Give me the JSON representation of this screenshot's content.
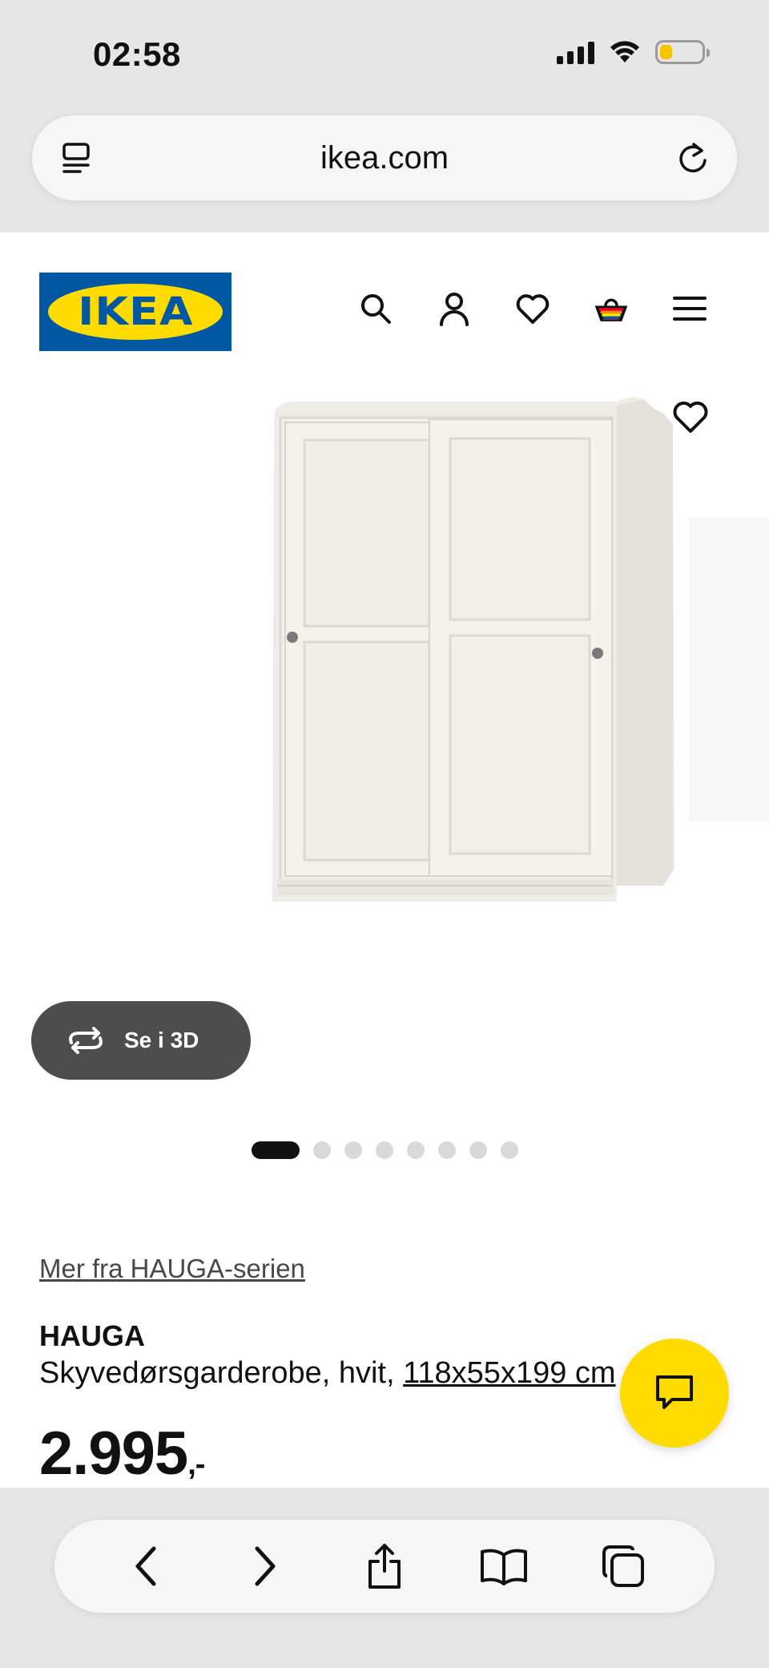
{
  "status_bar": {
    "time": "02:58",
    "battery_level": 0.3,
    "battery_color": "#f5c400"
  },
  "browser": {
    "url": "ikea.com",
    "left_icon": "reader-icon",
    "right_icon": "reload-icon"
  },
  "header": {
    "logo_text": "IKEA",
    "logo_colors": {
      "blue": "#0058a3",
      "yellow": "#ffdb00"
    },
    "icons": [
      "search-icon",
      "account-icon",
      "heart-icon",
      "basket-icon",
      "menu-icon"
    ]
  },
  "gallery": {
    "view_3d_label": "Se i 3D",
    "image_count": 8,
    "active_index": 0
  },
  "product": {
    "series_link": "Mer fra HAUGA-serien",
    "name": "HAUGA",
    "description": "Skyvedørsgarderobe, hvit, ",
    "dimensions": "118x55x199 cm",
    "price": "2.995",
    "price_suffix": ",-"
  },
  "chat": {
    "icon": "chat-icon",
    "color": "#ffdb00"
  },
  "bottom_nav": [
    "back-icon",
    "forward-icon",
    "share-icon",
    "bookmarks-icon",
    "tabs-icon"
  ]
}
